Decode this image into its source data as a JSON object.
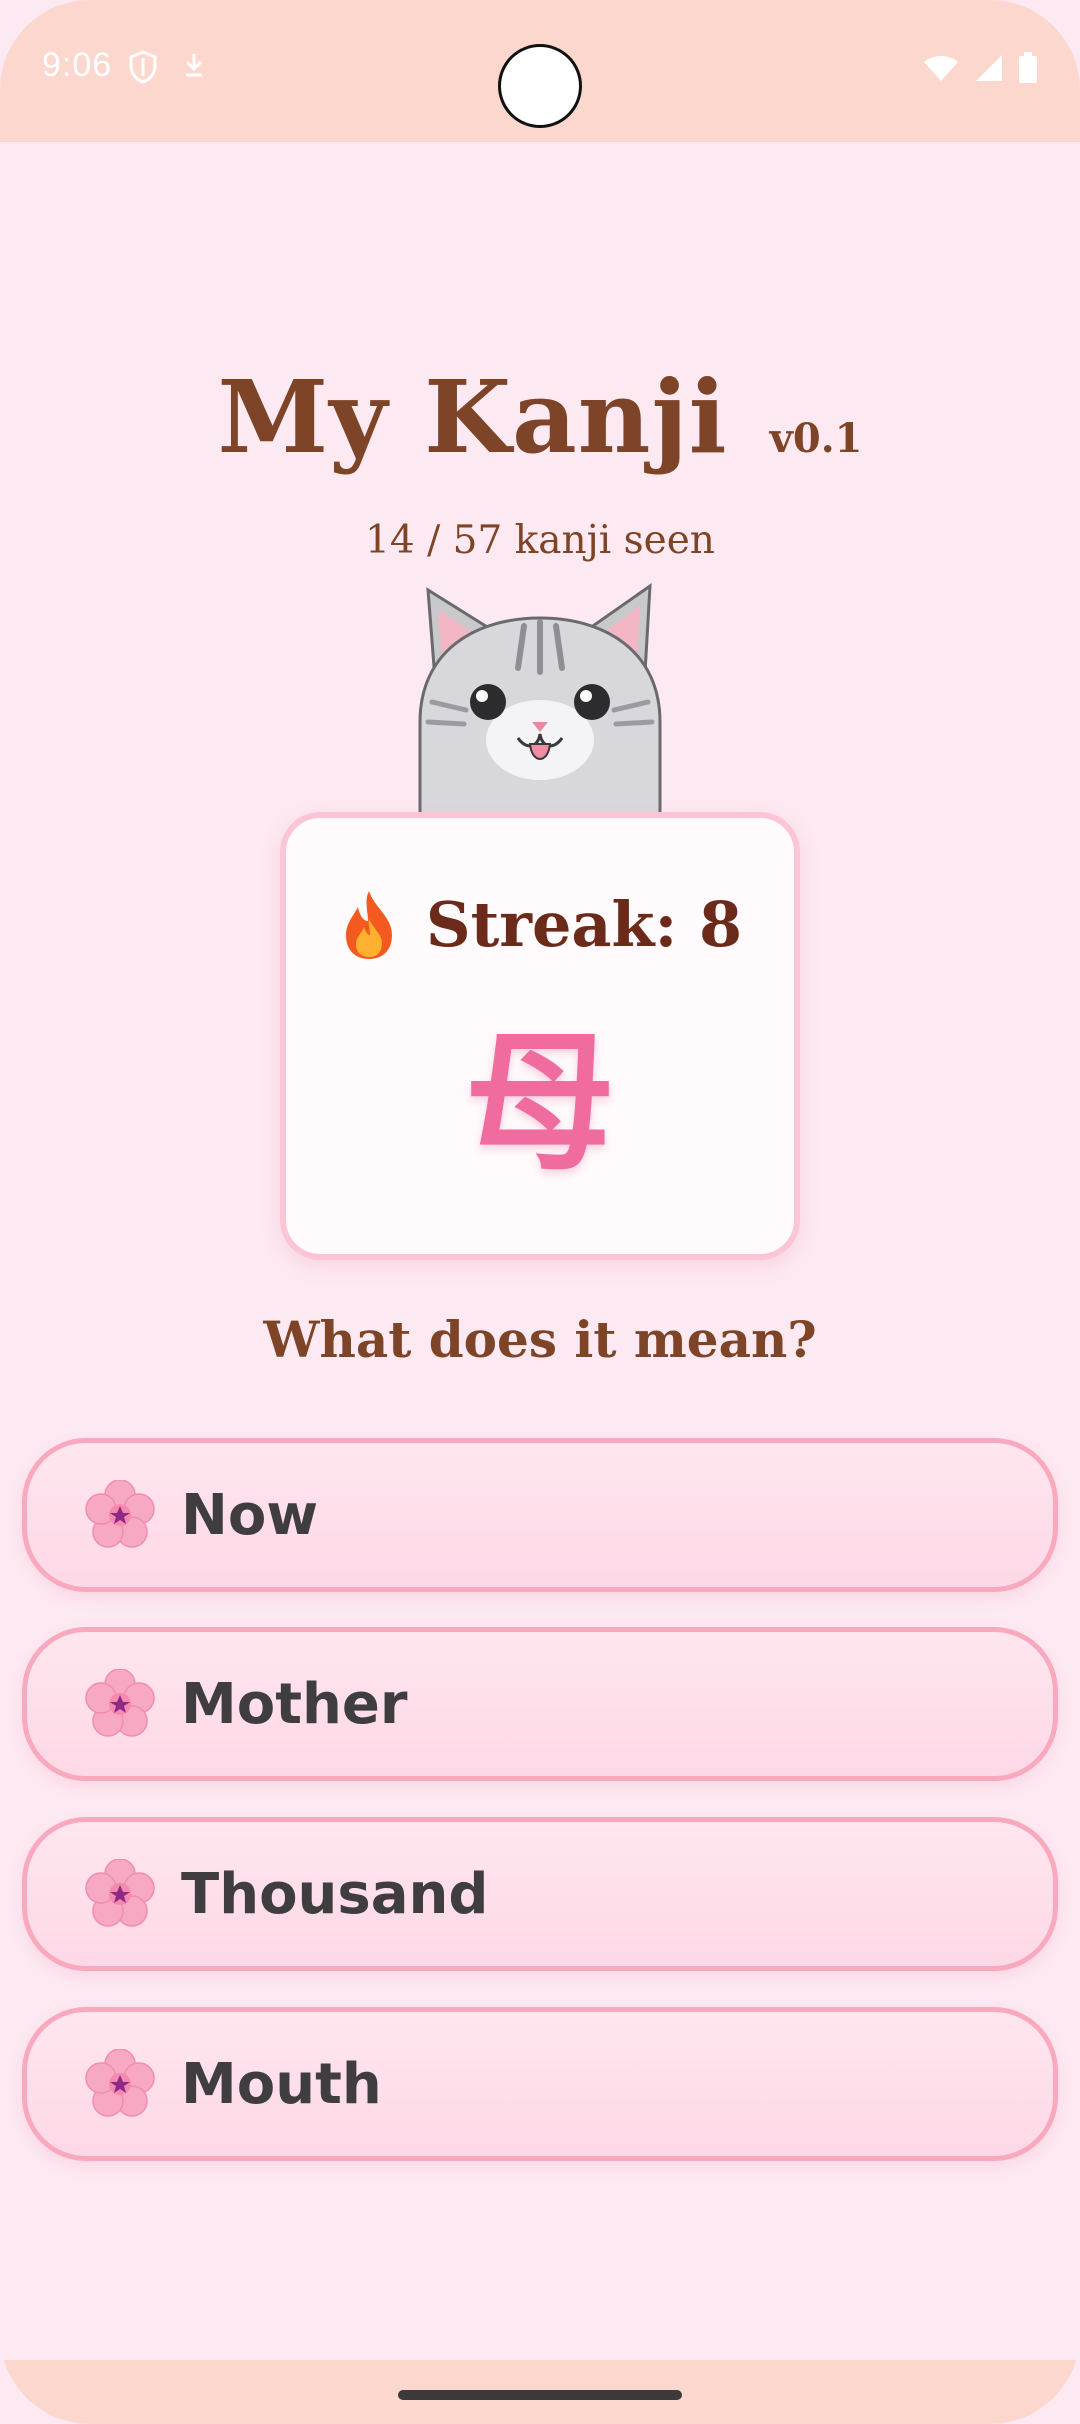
{
  "status_bar": {
    "time": "9:06"
  },
  "header": {
    "title": "My Kanji",
    "version": "v0.1",
    "progress": "14 / 57 kanji seen"
  },
  "card": {
    "streak_label": "Streak: 8",
    "kanji": "母"
  },
  "question": "What does it mean?",
  "answers": [
    {
      "label": "Now"
    },
    {
      "label": "Mother"
    },
    {
      "label": "Thousand"
    },
    {
      "label": "Mouth"
    }
  ],
  "colors": {
    "background": "#fde9f2",
    "status_bar": "#fcd7cd",
    "title": "#7d4427",
    "kanji": "#f06c9e",
    "card_border": "#fcc5d6",
    "answer_border": "#f9a9bd",
    "answer_text": "#3f3d40"
  },
  "icons": {
    "status_left": [
      "shield-icon",
      "download-icon"
    ],
    "status_right": [
      "wifi-icon",
      "signal-icon",
      "battery-icon"
    ],
    "mascot": "cat-mascot",
    "streak": "fire-icon",
    "answer": "sakura-flower-icon"
  }
}
